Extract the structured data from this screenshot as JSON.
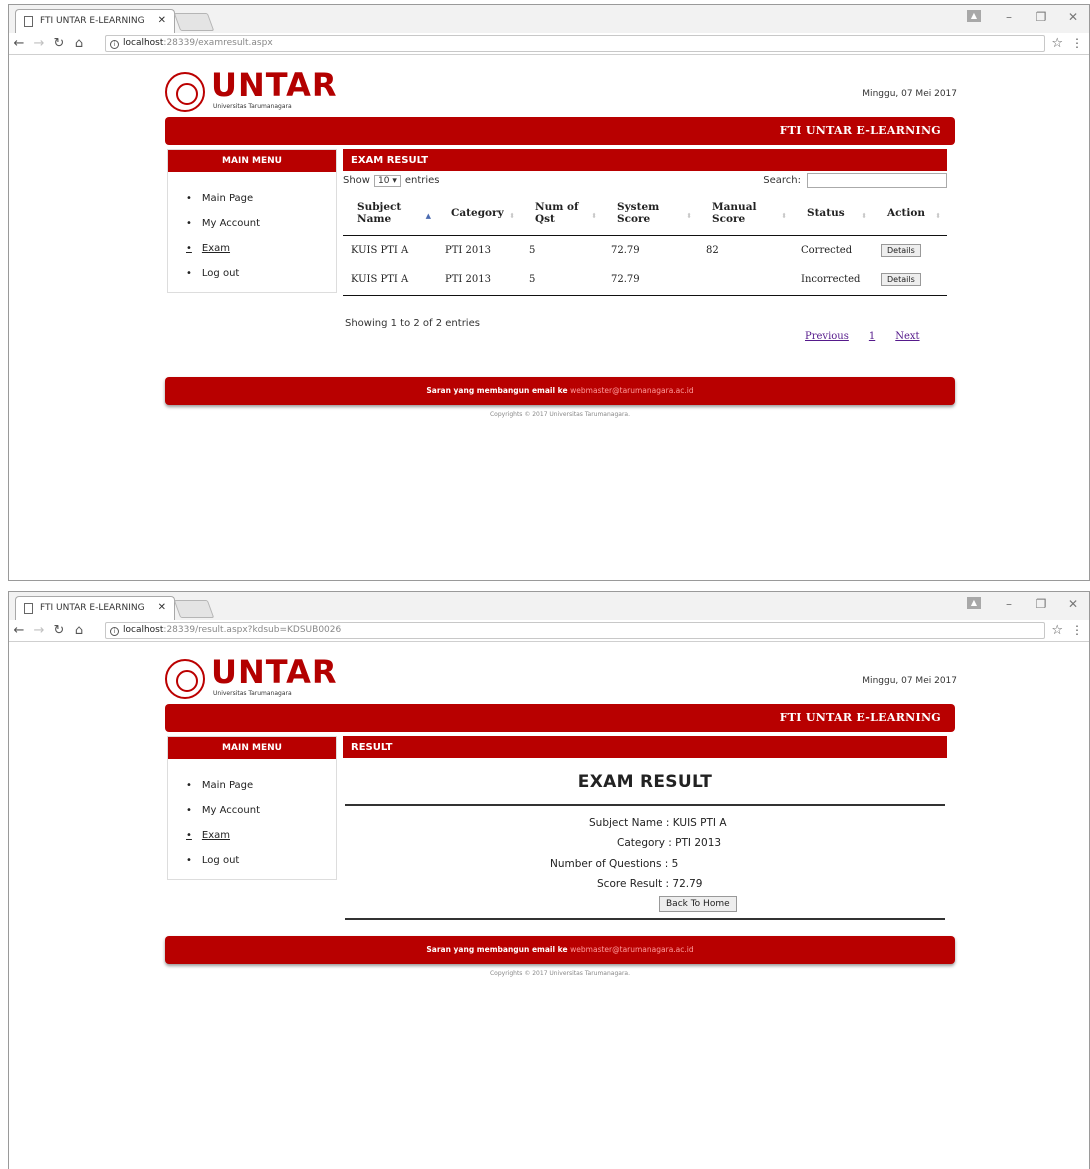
{
  "windows": [
    {
      "tab_title": "FTI UNTAR E-LEARNING",
      "url_host": "localhost",
      "url_rest": ":28339/examresult.aspx",
      "logo_text": "UNTAR",
      "logo_subtitle": "Universitas Tarumanagara",
      "date": "Minggu, 07 Mei 2017",
      "header_title": "FTI UNTAR E-LEARNING",
      "sidebar": {
        "heading": "MAIN MENU",
        "items": [
          "Main Page",
          "My Account",
          "Exam",
          "Log out"
        ]
      },
      "panel_title": "EXAM RESULT",
      "table_controls": {
        "show_label": "Show",
        "page_length": "10",
        "entries_label": "entries",
        "search_label": "Search:"
      },
      "table": {
        "columns": [
          {
            "line1": "Subject",
            "line2": "Name"
          },
          {
            "line1": "Category",
            "line2": ""
          },
          {
            "line1": "Num of",
            "line2": "Qst"
          },
          {
            "line1": "System",
            "line2": "Score"
          },
          {
            "line1": "Manual",
            "line2": "Score"
          },
          {
            "line1": "Status",
            "line2": ""
          },
          {
            "line1": "Action",
            "line2": ""
          }
        ],
        "rows": [
          {
            "subject": "KUIS PTI A",
            "category": "PTI 2013",
            "num_qst": "5",
            "system_score": "72.79",
            "manual_score": "82",
            "status": "Corrected",
            "action": "Details"
          },
          {
            "subject": "KUIS PTI A",
            "category": "PTI 2013",
            "num_qst": "5",
            "system_score": "72.79",
            "manual_score": "",
            "status": "Incorrected",
            "action": "Details"
          }
        ]
      },
      "info_text": "Showing 1 to 2 of 2 entries",
      "pager": {
        "previous": "Previous",
        "page": "1",
        "next": "Next"
      },
      "footer": {
        "text": "Saran yang membangun email ke",
        "email": "webmaster@tarumanagara.ac.id",
        "copyright": "Copyrights © 2017 Universitas Tarumanagara."
      }
    },
    {
      "tab_title": "FTI UNTAR E-LEARNING",
      "url_host": "localhost",
      "url_rest": ":28339/result.aspx?kdsub=KDSUB0026",
      "logo_text": "UNTAR",
      "logo_subtitle": "Universitas Tarumanagara",
      "date": "Minggu, 07 Mei 2017",
      "header_title": "FTI UNTAR E-LEARNING",
      "sidebar": {
        "heading": "MAIN MENU",
        "items": [
          "Main Page",
          "My Account",
          "Exam",
          "Log out"
        ]
      },
      "panel_title": "RESULT",
      "result": {
        "title": "EXAM RESULT",
        "subject": "Subject Name : KUIS PTI A",
        "category": "Category : PTI 2013",
        "num_questions": "Number of Questions : 5",
        "score": "Score Result : 72.79",
        "back_button": "Back To Home"
      },
      "footer": {
        "text": "Saran yang membangun email ke",
        "email": "webmaster@tarumanagara.ac.id",
        "copyright": "Copyrights © 2017 Universitas Tarumanagara."
      }
    }
  ]
}
